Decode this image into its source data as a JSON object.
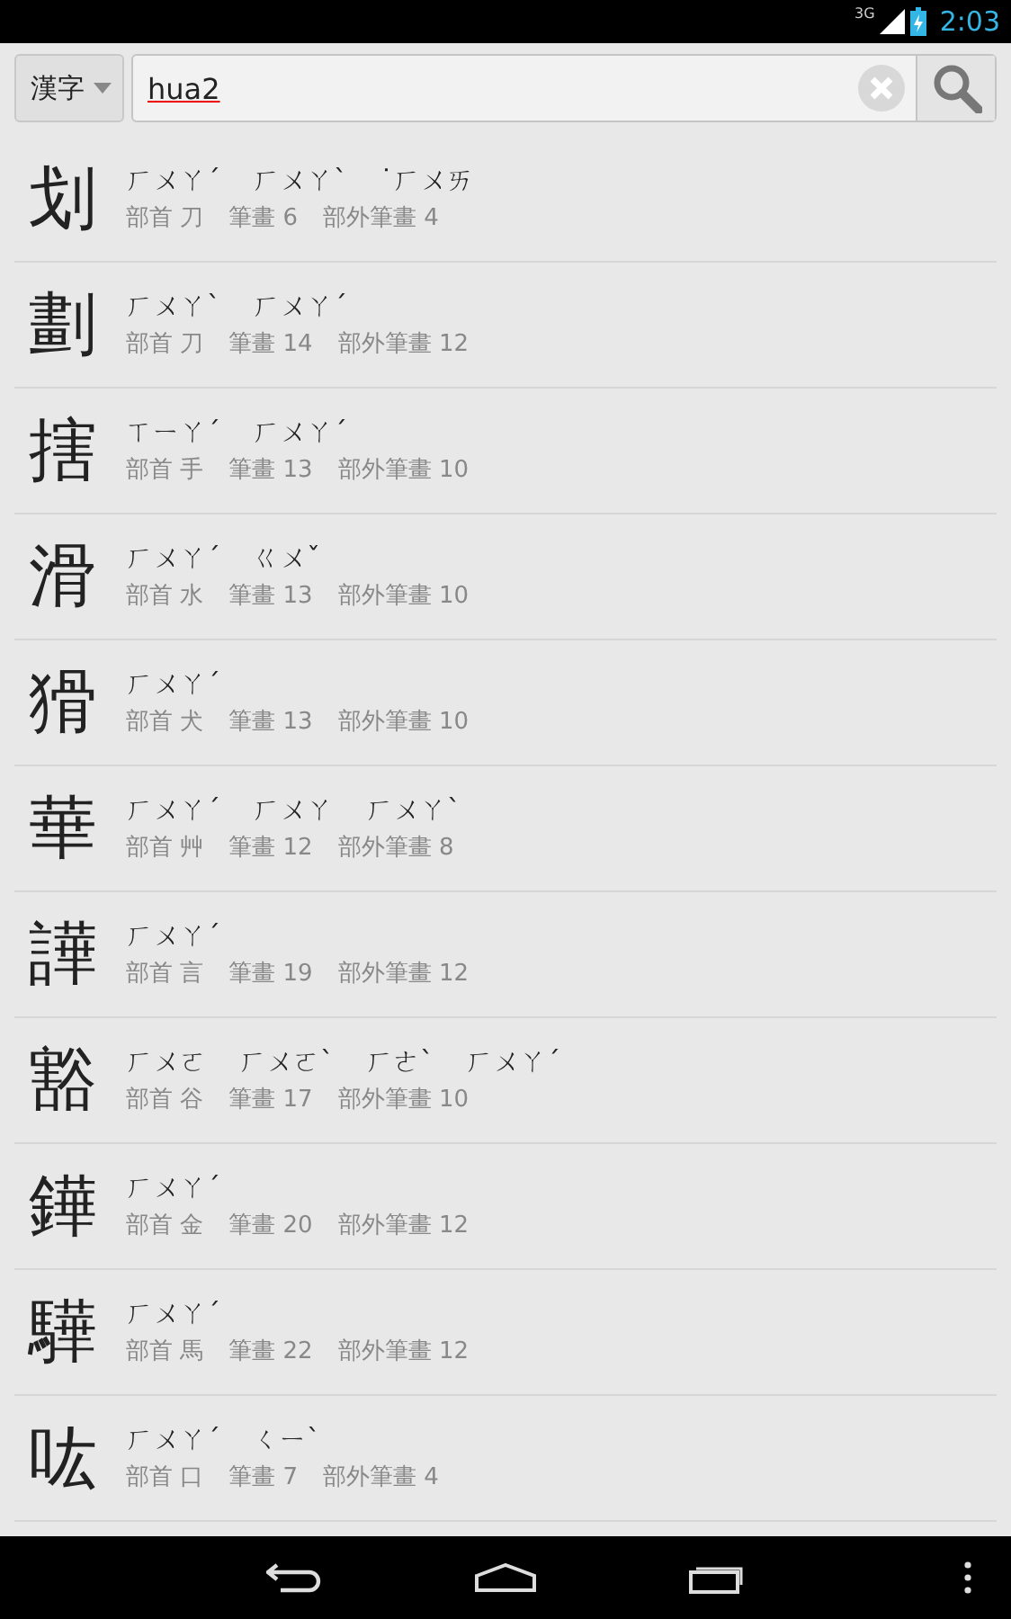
{
  "status_bar": {
    "network": "3G",
    "time": "2:03"
  },
  "search": {
    "mode": "漢字",
    "value": "hua2"
  },
  "results": [
    {
      "char": "划",
      "readings": [
        "ㄏㄨㄚˊ",
        "ㄏㄨㄚˋ",
        "˙ㄏㄨㄞ"
      ],
      "radical": "部首 刀",
      "strokes": "筆畫 6",
      "extra_strokes": "部外筆畫 4"
    },
    {
      "char": "劃",
      "readings": [
        "ㄏㄨㄚˋ",
        "ㄏㄨㄚˊ"
      ],
      "radical": "部首 刀",
      "strokes": "筆畫 14",
      "extra_strokes": "部外筆畫 12"
    },
    {
      "char": "搳",
      "readings": [
        "ㄒㄧㄚˊ",
        "ㄏㄨㄚˊ"
      ],
      "radical": "部首 手",
      "strokes": "筆畫 13",
      "extra_strokes": "部外筆畫 10"
    },
    {
      "char": "滑",
      "readings": [
        "ㄏㄨㄚˊ",
        "ㄍㄨˇ"
      ],
      "radical": "部首 水",
      "strokes": "筆畫 13",
      "extra_strokes": "部外筆畫 10"
    },
    {
      "char": "猾",
      "readings": [
        "ㄏㄨㄚˊ"
      ],
      "radical": "部首 犬",
      "strokes": "筆畫 13",
      "extra_strokes": "部外筆畫 10"
    },
    {
      "char": "華",
      "readings": [
        "ㄏㄨㄚˊ",
        "ㄏㄨㄚ",
        "ㄏㄨㄚˋ"
      ],
      "radical": "部首 艸",
      "strokes": "筆畫 12",
      "extra_strokes": "部外筆畫 8"
    },
    {
      "char": "譁",
      "readings": [
        "ㄏㄨㄚˊ"
      ],
      "radical": "部首 言",
      "strokes": "筆畫 19",
      "extra_strokes": "部外筆畫 12"
    },
    {
      "char": "豁",
      "readings": [
        "ㄏㄨㄛ",
        "ㄏㄨㄛˋ",
        "ㄏㄜˋ",
        "ㄏㄨㄚˊ"
      ],
      "radical": "部首 谷",
      "strokes": "筆畫 17",
      "extra_strokes": "部外筆畫 10"
    },
    {
      "char": "鏵",
      "readings": [
        "ㄏㄨㄚˊ"
      ],
      "radical": "部首 金",
      "strokes": "筆畫 20",
      "extra_strokes": "部外筆畫 12"
    },
    {
      "char": "驊",
      "readings": [
        "ㄏㄨㄚˊ"
      ],
      "radical": "部首 馬",
      "strokes": "筆畫 22",
      "extra_strokes": "部外筆畫 12"
    },
    {
      "char": "吰",
      "readings": [
        "ㄏㄨㄚˊ",
        "ㄑㄧˋ"
      ],
      "radical": "部首 口",
      "strokes": "筆畫 7",
      "extra_strokes": "部外筆畫 4"
    }
  ]
}
